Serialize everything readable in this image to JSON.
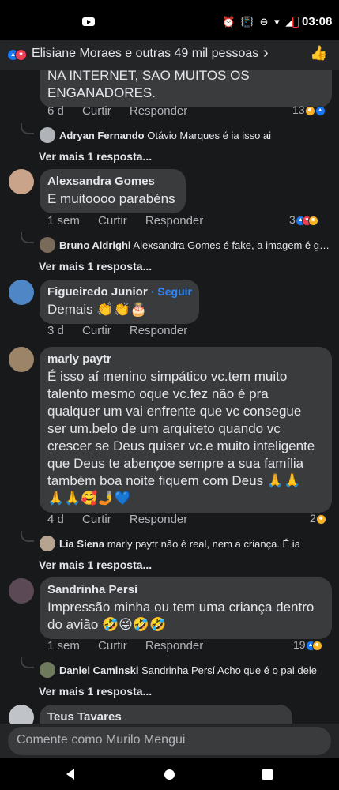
{
  "status_bar": {
    "time": "03:08",
    "icons": "⏰ 📳 ⊖ ▾ ◢"
  },
  "reactions_bar": {
    "summary": "Elisiane Moraes e outras 49 mil pessoas",
    "chevron": "›",
    "like_glyph": "👍"
  },
  "actions": {
    "like": "Curtir",
    "reply": "Responder"
  },
  "comments": [
    {
      "text": "NA INTERNET, SÃO  MUITOS OS\nENGANADORES.",
      "time": "6 d",
      "count": "13",
      "reply": {
        "name": "Adryan Fernando",
        "text": "Otávio Marques é ia isso ai"
      },
      "more": "Ver mais 1 resposta..."
    },
    {
      "name": "Alexsandra Gomes",
      "text": "E muitoooo parabéns",
      "time": "1 sem",
      "count": "3",
      "reply": {
        "name": "Bruno Aldrighi",
        "text": "Alexsandra Gomes é fake, a imagem é gerada por ia"
      },
      "more": "Ver mais 1 resposta..."
    },
    {
      "name": "Figueiredo Junior",
      "follow": "· Seguir",
      "text": "Demais 👏👏🎂",
      "time": "3 d"
    },
    {
      "name": "marly paytr",
      "text": "É isso aí menino simpático vc.tem muito\ntalento mesmo oque vc.fez não é pra\nqualquer um vai enfrente que vc consegue\nser um.belo de um arquiteto quando vc\ncrescer se Deus quiser vc.e muito inteligente\nque Deus te abençoe sempre a sua família\ntambém boa noite fiquem com Deus 🙏🙏\n🙏🙏🥰🤳💙",
      "time": "4 d",
      "count": "2",
      "reply": {
        "name": "Lia Siena",
        "text": "marly paytr não é real, nem a criança. É ia"
      },
      "more": "Ver mais 1 resposta..."
    },
    {
      "name": "Sandrinha Persí",
      "text": "Impressão minha ou tem uma criança dentro\ndo avião 🤣😜🤣🤣",
      "time": "1 sem",
      "count": "19",
      "reply": {
        "name": "Daniel Caminski",
        "text": "Sandrinha Persí Acho que é o pai dele"
      },
      "more": "Ver mais 1 resposta..."
    },
    {
      "name": "Teus Tavares"
    }
  ],
  "composer": {
    "placeholder": "Comente como Murilo Mengui"
  },
  "colors": {
    "background": "#18191a",
    "bubble": "#3a3b3c",
    "link": "#2d88ff",
    "like": "#1877f2"
  }
}
